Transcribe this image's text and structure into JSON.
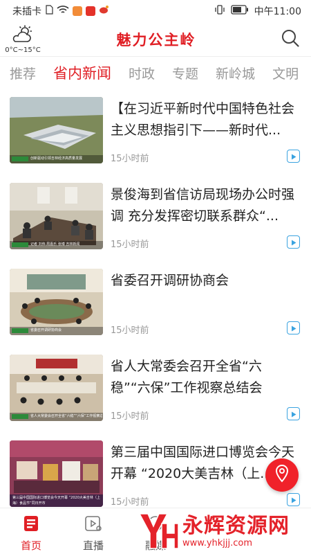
{
  "status_bar": {
    "carrier": "未插卡",
    "time": "中午11:00"
  },
  "header": {
    "weather_temp": "0°C~15°C",
    "title": "魅力公主岭",
    "icons": {
      "weather": "partly-cloudy-icon",
      "search": "search-icon"
    }
  },
  "tabs": [
    {
      "label": "推荐",
      "active": false
    },
    {
      "label": "省内新闻",
      "active": true
    },
    {
      "label": "时政",
      "active": false
    },
    {
      "label": "专题",
      "active": false
    },
    {
      "label": "新岭城",
      "active": false
    },
    {
      "label": "文明",
      "active": false
    }
  ],
  "news": [
    {
      "title": "【在习近平新时代中国特色社会主义思想指引下——新时代...",
      "time": "15小时前",
      "caption": "创新驱动引领吉林经济高质量发展"
    },
    {
      "title": "景俊海到省信访局现场办公时强调 充分发挥密切联系群众“...",
      "time": "15小时前",
      "caption": "记者 刘伟 周嘉乐 张博 吉林新闻"
    },
    {
      "title": "省委召开调研协商会",
      "time": "15小时前",
      "caption": "省委召开调研协商会"
    },
    {
      "title": "省人大常委会召开全省“六稳”“六保”工作视察总结会",
      "time": "15小时前",
      "caption": "省人大常委会召开全省“六稳”“六保”工作视察总结会"
    },
    {
      "title": "第三届中国国际进口博览会今天开幕 “2020大美吉林（上...",
      "time": "15小时前",
      "caption": "第三届中国国际进口博览会今天开幕 “2020大美吉林（上海）食品节”同日开市"
    }
  ],
  "bottom_nav": [
    {
      "label": "首页",
      "icon": "home-doc-icon",
      "active": true
    },
    {
      "label": "直播",
      "icon": "live-play-icon",
      "active": false
    },
    {
      "label": "融媒",
      "icon": "media-icon",
      "active": false
    }
  ],
  "watermark": {
    "title": "永辉资源网",
    "url": "www.yhkjjj.com"
  },
  "colors": {
    "brand_red": "#e01e24",
    "play_blue": "#3aa3e0",
    "muted_gray": "#999999"
  }
}
